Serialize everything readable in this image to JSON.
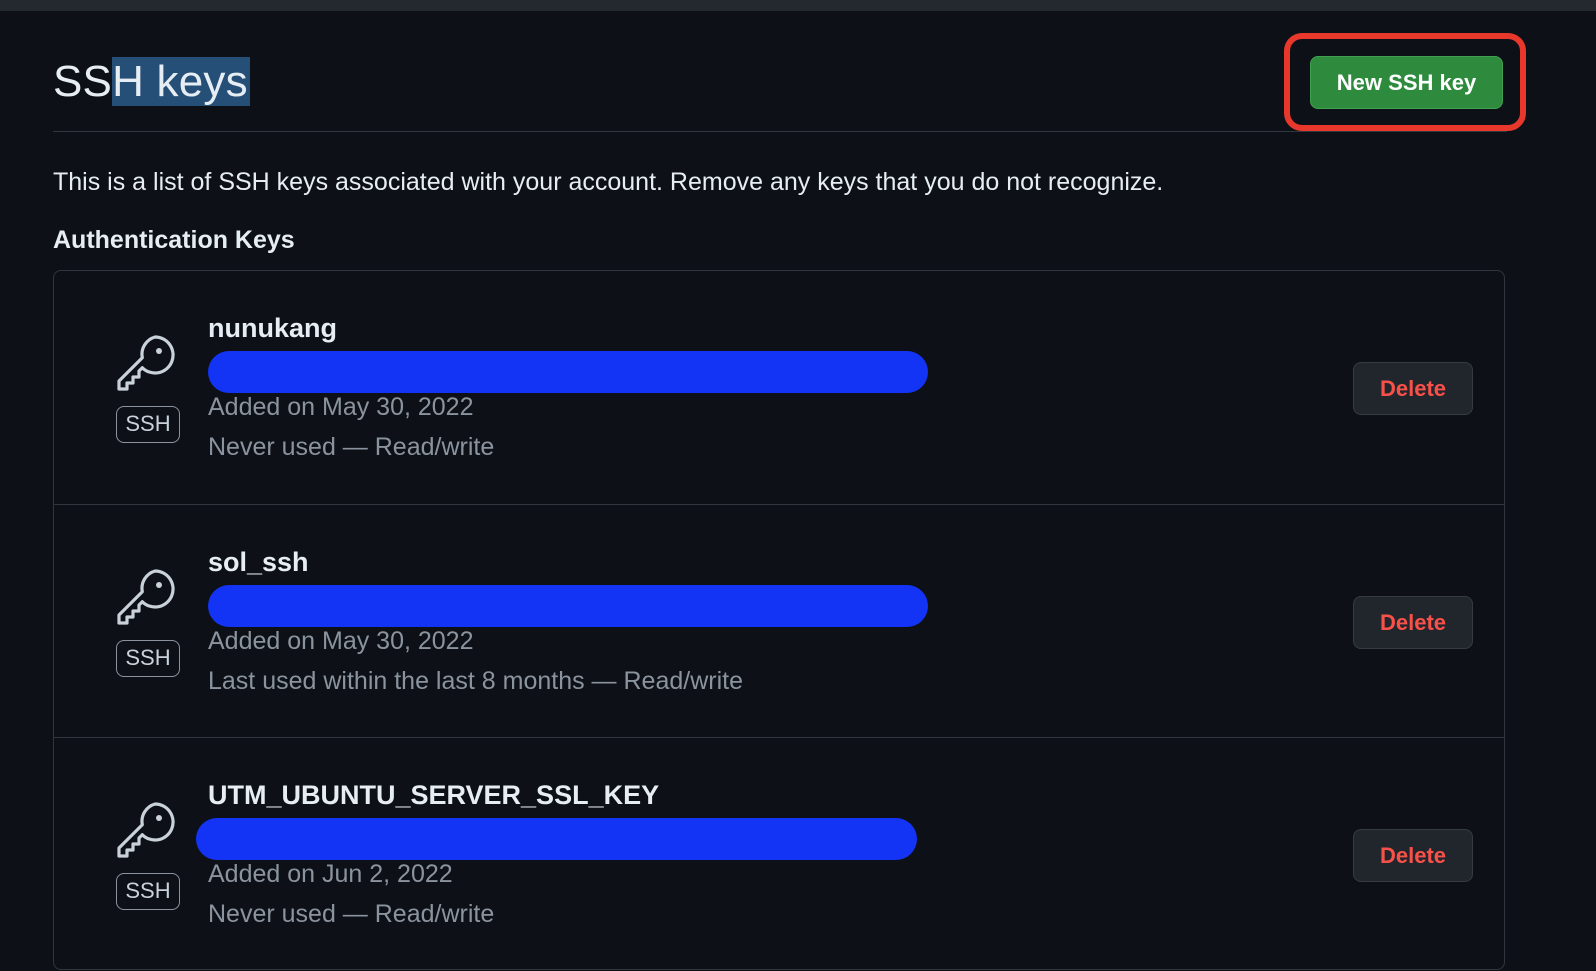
{
  "header": {
    "title_start": "SS",
    "title_selected": "H keys",
    "new_key_label": "New SSH key"
  },
  "description": "This is a list of SSH keys associated with your account. Remove any keys that you do not recognize.",
  "section_title": "Authentication Keys",
  "keys": [
    {
      "name": "nunukang",
      "badge": "SSH",
      "added": "Added on May 30, 2022",
      "usage": "Never used — Read/write",
      "delete_label": "Delete",
      "icon": "key-icon"
    },
    {
      "name": "sol_ssh",
      "badge": "SSH",
      "added": "Added on May 30, 2022",
      "usage": "Last used within the last 8 months — Read/write",
      "delete_label": "Delete",
      "icon": "key-icon"
    },
    {
      "name": "UTM_UBUNTU_SERVER_SSL_KEY",
      "badge": "SSH",
      "added": "Added on Jun 2, 2022",
      "usage": "Never used — Read/write",
      "delete_label": "Delete",
      "icon": "key-icon"
    }
  ],
  "colors": {
    "background": "#0d1117",
    "primary_button": "#2e8b3e",
    "danger_text": "#f85149",
    "highlight_border": "#e8382c",
    "redaction": "#1434f5",
    "text_selection": "#264f78"
  }
}
